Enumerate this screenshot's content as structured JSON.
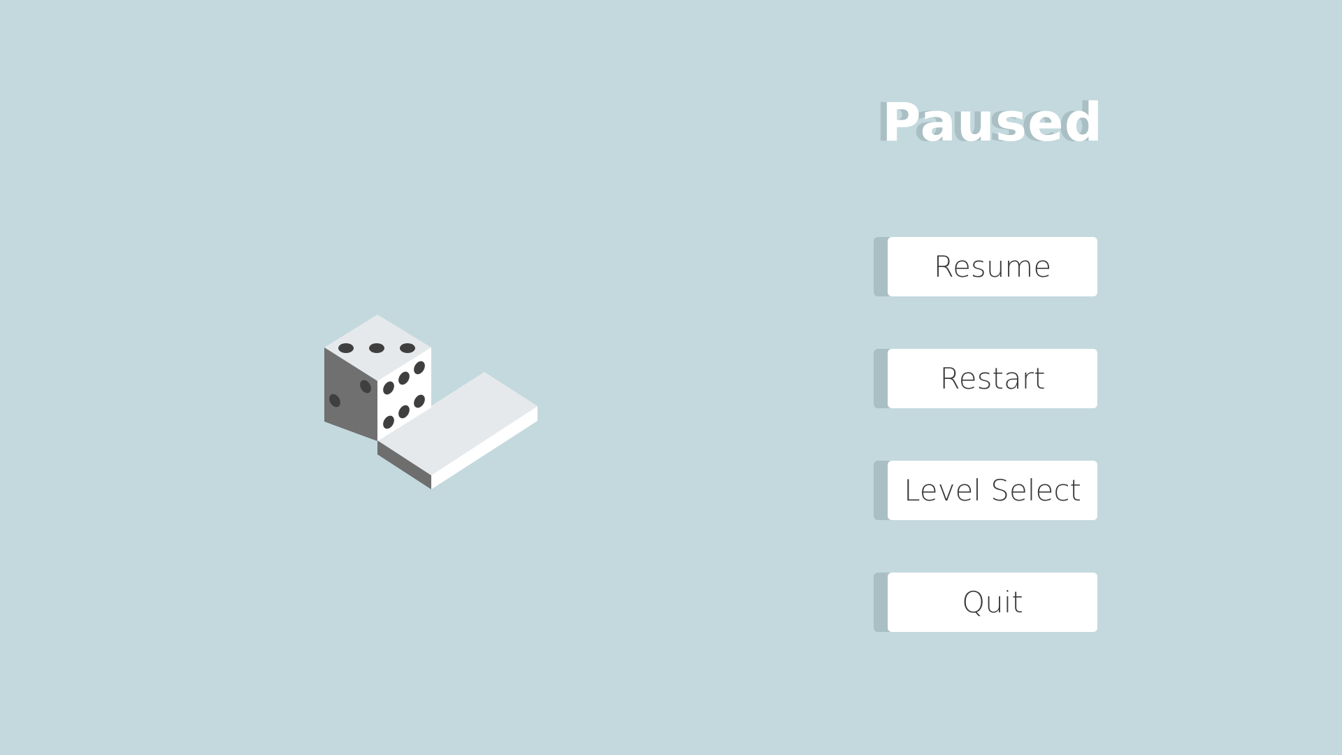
{
  "pause_menu": {
    "title": "Paused",
    "buttons": [
      {
        "label": "Resume"
      },
      {
        "label": "Restart"
      },
      {
        "label": "Level Select"
      },
      {
        "label": "Quit"
      }
    ]
  },
  "scene": {
    "die": {
      "top_face_pips": 3,
      "left_face_pips": 2,
      "right_face_pips": 6
    }
  },
  "colors": {
    "background": "#c3d9de",
    "button_shadow": "#a9bfc4",
    "button_face": "#ffffff",
    "text_dark": "#3a3a3a",
    "pip": "#3f3f3f",
    "die_top": "#e6e9ec",
    "die_left": "#707070",
    "die_right": "#ffffff",
    "tile_top": "#e6e9ec",
    "tile_front_left": "#6e6e6e",
    "tile_front_right": "#ffffff"
  }
}
